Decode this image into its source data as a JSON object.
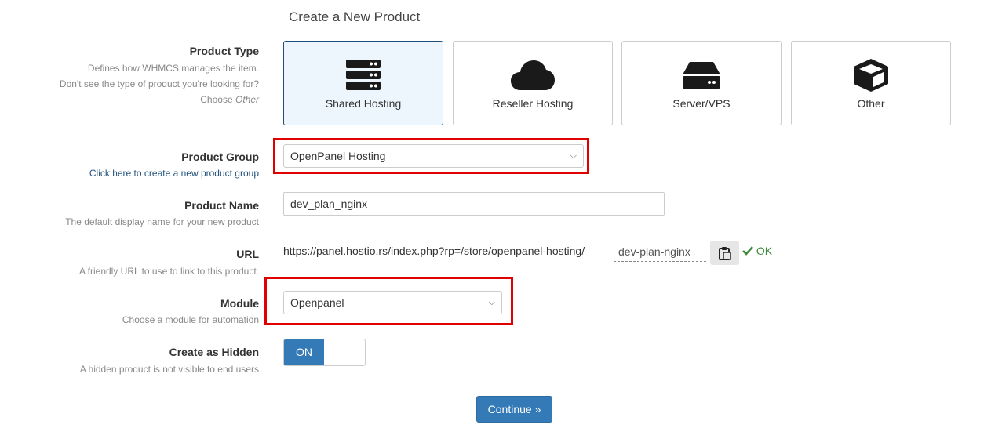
{
  "page_title": "Create a New Product",
  "product_type": {
    "label": "Product Type",
    "desc_line1": "Defines how WHMCS manages the item.",
    "desc_line2": "Don't see the type of product you're looking for?",
    "desc_choose": "Choose",
    "desc_other": "Other",
    "options": [
      {
        "label": "Shared Hosting",
        "icon": "server-stack-icon",
        "selected": true
      },
      {
        "label": "Reseller Hosting",
        "icon": "cloud-icon",
        "selected": false
      },
      {
        "label": "Server/VPS",
        "icon": "server-icon",
        "selected": false
      },
      {
        "label": "Other",
        "icon": "cube-icon",
        "selected": false
      }
    ]
  },
  "product_group": {
    "label": "Product Group",
    "link": "Click here to create a new product group",
    "value": "OpenPanel Hosting"
  },
  "product_name": {
    "label": "Product Name",
    "desc": "The default display name for your new product",
    "value": "dev_plan_nginx"
  },
  "url": {
    "label": "URL",
    "desc": "A friendly URL to use to link to this product.",
    "base": "https://panel.hostio.rs/index.php?rp=/store/openpanel-hosting/",
    "slug": "dev-plan-nginx",
    "status": "OK",
    "copy_icon": "clipboard-icon",
    "status_icon": "check-icon"
  },
  "module": {
    "label": "Module",
    "desc": "Choose a module for automation",
    "value": "Openpanel"
  },
  "hidden": {
    "label": "Create as Hidden",
    "desc": "A hidden product is not visible to end users",
    "toggle": "ON"
  },
  "continue_label": "Continue »",
  "colors": {
    "primary": "#337ab7",
    "highlight": "#e00000",
    "ok": "#3c8a3c",
    "selected_card_bg": "#edf6fd"
  }
}
